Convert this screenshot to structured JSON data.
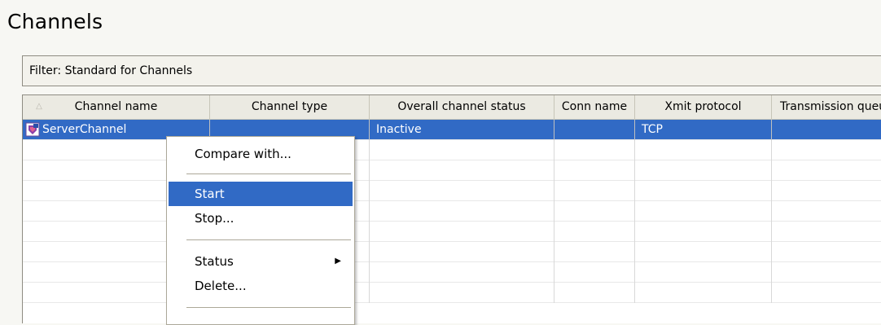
{
  "view": {
    "title": "Channels"
  },
  "filter": {
    "label": "Filter: Standard for Channels"
  },
  "table": {
    "columns": [
      "Channel name",
      "Channel type",
      "Overall channel status",
      "Conn name",
      "Xmit protocol",
      "Transmission queue"
    ],
    "sorted_column": "Channel name",
    "rows": [
      {
        "channel_name": "ServerChannel",
        "channel_type": "",
        "overall_status": "Inactive",
        "conn_name": "",
        "xmit_protocol": "TCP",
        "transmission_queue": ""
      }
    ]
  },
  "context_menu": {
    "items": [
      "Compare with...",
      "Start",
      "Stop...",
      "Status",
      "Delete..."
    ],
    "highlighted": "Start"
  },
  "colors": {
    "selection": "#316ac5",
    "header_bg": "#ebeae2",
    "background": "#f7f7f3"
  }
}
